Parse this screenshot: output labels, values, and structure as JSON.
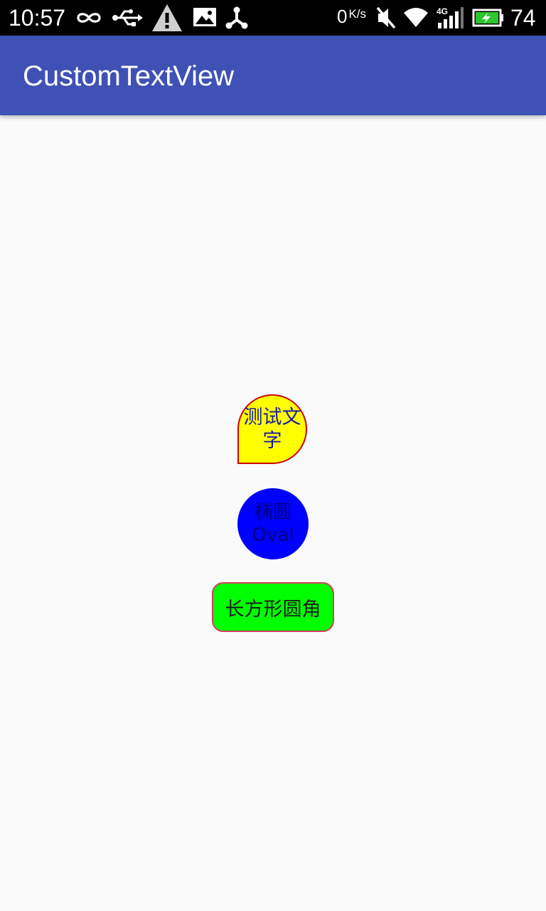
{
  "status_bar": {
    "time": "10:57",
    "net_speed_value": "0",
    "net_speed_unit": "K/s",
    "signal_type": "4G",
    "battery_percent": "74",
    "icons": [
      "infinity-icon",
      "usb-icon",
      "warning-icon",
      "image-icon",
      "share-icon",
      "mute-icon",
      "wifi-icon",
      "cell-signal-icon",
      "battery-charging-icon"
    ]
  },
  "app_bar": {
    "title": "CustomTextView"
  },
  "views": {
    "drop_text": "测试文字",
    "oval_text_line1": "椭圆",
    "oval_text_line2": "Oval",
    "rect_text": "长方形圆角"
  },
  "colors": {
    "status_bar": "#000000",
    "app_bar": "#3f51b5",
    "background": "#fafafa",
    "drop_fill": "#ffff00",
    "drop_border": "#cc0000",
    "oval_fill": "#0000ff",
    "rect_fill": "#00ff00",
    "rect_border": "#d04060"
  }
}
